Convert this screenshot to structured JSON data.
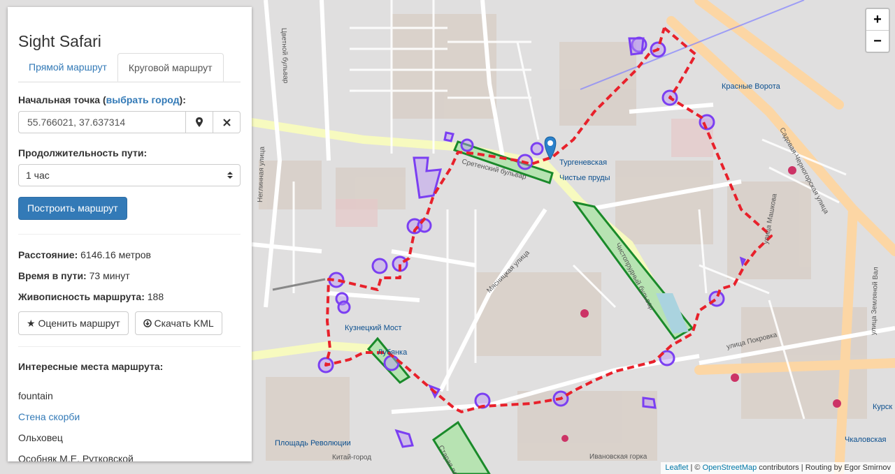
{
  "app": {
    "title": "Sight Safari"
  },
  "tabs": [
    "Прямой маршрут",
    "Круговой маршрут"
  ],
  "start": {
    "label_prefix": "Начальная точка (",
    "label_link": "выбрать город",
    "label_suffix": "):",
    "value": "55.766021, 37.637314"
  },
  "duration": {
    "label": "Продолжительность пути:",
    "selected": "1 час"
  },
  "build_button": "Построить маршрут",
  "stats": {
    "distance_label": "Расстояние:",
    "distance_value": " 6146.16 метров",
    "time_label": "Время в пути:",
    "time_value": " 73 минут",
    "scenic_label": "Живописность маршрута:",
    "scenic_value": " 188"
  },
  "actions": {
    "rate": "Оценить маршрут",
    "kml": "Скачать KML"
  },
  "poi": {
    "header": "Интересные места маршрута:",
    "items": [
      "fountain",
      "Стена скорби",
      "Ольховец",
      "Особняк М.Е. Рутковской"
    ]
  },
  "zoom": {
    "in": "+",
    "out": "−"
  },
  "attribution": {
    "leaflet": "Leaflet",
    "sep1": " | © ",
    "osm": "OpenStreetMap",
    "rest": " contributors | Routing by Egor Smirnov"
  },
  "map_labels": {
    "sretensky_bulvar": "Сретенский бульвар",
    "chistye_prudy": "Чистые пруды",
    "krasnye_vorota": "Красные Ворота",
    "kuznetsky_most": "Кузнецкий Мост",
    "lubyanka": "Лубянка",
    "ploshchad_revolyutsii": "Площадь Революции",
    "kitay_gorod": "Китай-город",
    "myasnitskaya": "Мясницкая улица",
    "pokrovka": "улица Покровка",
    "sadovaya": "Садовая-Черногорская улица",
    "zemlyanoy_val": "улица Земляной Вал",
    "kurskaya": "Курск",
    "chkalovskaya": "Чкаловская",
    "ivanovskaya": "Ивановская горка",
    "tsvetnoy": "Цветной бульвар",
    "turgenevskaya": "Тургеневская",
    "neglinnaya": "Неглинная улица",
    "ulitsa_mashkova": "улица Машкова",
    "chistoprudny": "Чистопрудный бульвар",
    "staraya_ploshchad": "Старая площадь"
  },
  "colors": {
    "route": "#e8212b",
    "poi_outline": "#7b3ff2",
    "park": "#1a8a2a",
    "accent": "#337ab7"
  }
}
